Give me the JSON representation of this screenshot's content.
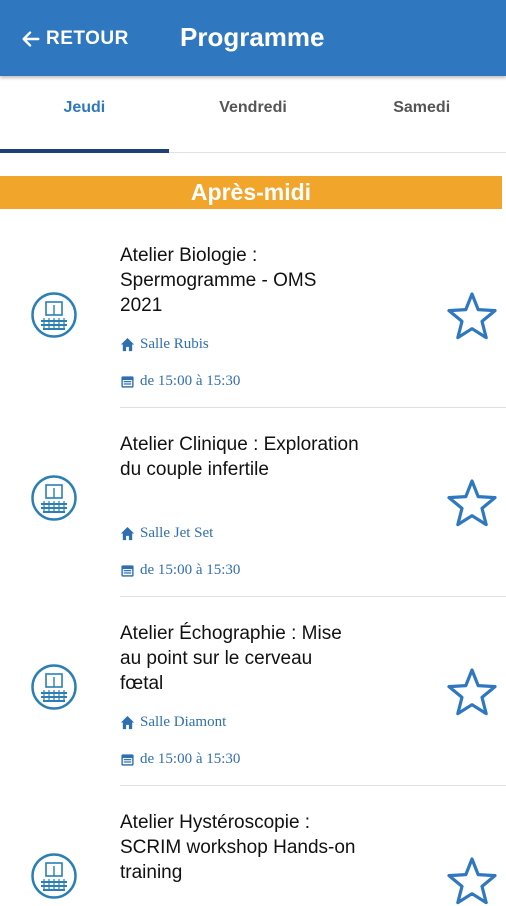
{
  "header": {
    "back_label": "RETOUR",
    "title": "Programme"
  },
  "tabs": [
    {
      "label": "Jeudi",
      "active": true
    },
    {
      "label": "Vendredi",
      "active": false
    },
    {
      "label": "Samedi",
      "active": false
    }
  ],
  "section": {
    "title": "Après-midi"
  },
  "sessions": [
    {
      "title": "Atelier Biologie : Spermogramme - OMS 2021",
      "room": "Salle Rubis",
      "time": "de 15:00 à 15:30"
    },
    {
      "title": "Atelier Clinique : Exploration du couple infertile",
      "room": "Salle Jet Set",
      "time": "de 15:00 à 15:30"
    },
    {
      "title": "Atelier Échographie : Mise au point sur le cerveau fœtal",
      "room": "Salle Diamont",
      "time": "de 15:00 à 15:30"
    },
    {
      "title": "Atelier Hystéroscopie : SCRIM workshop Hands-on training",
      "room": "",
      "time": ""
    }
  ],
  "colors": {
    "header": "#2f78bf",
    "accent": "#2f78bf",
    "section": "#f2a52b",
    "tab_indicator": "#1e3f7a",
    "icon": "#2a7fb5"
  },
  "icons": {
    "back": "arrow-left-icon",
    "session": "workshop-icon",
    "room": "home-icon",
    "time": "calendar-icon",
    "favorite": "star-outline-icon"
  }
}
